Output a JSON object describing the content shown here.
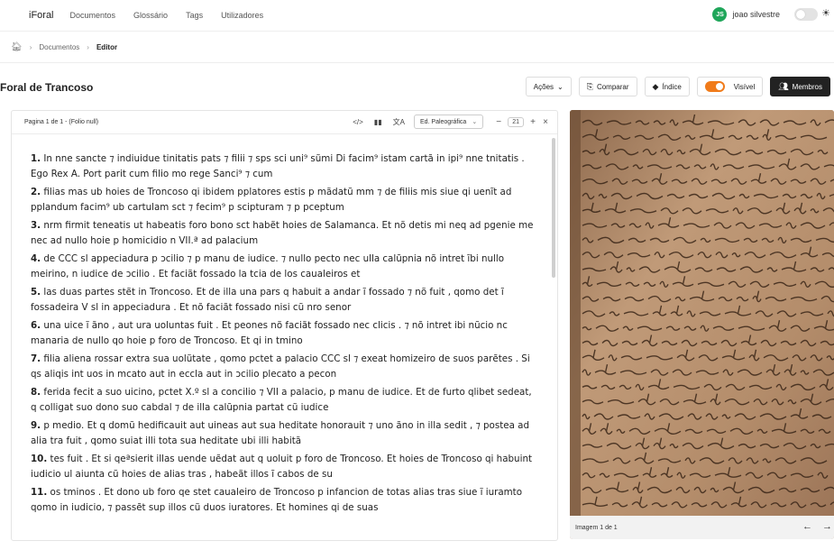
{
  "topnav": {
    "brand": "iForal",
    "links": [
      "Documentos",
      "Glossário",
      "Tags",
      "Utilizadores"
    ],
    "user": {
      "initials": "JS",
      "name": "joao silvestre",
      "avatar_color": "#1fa65a"
    }
  },
  "breadcrumb": {
    "items": [
      "Documentos",
      "Editor"
    ]
  },
  "header": {
    "title": "Foral de Trancoso",
    "buttons": {
      "actions": "Ações",
      "compare": "Comparar",
      "index": "Índice",
      "visible": "Visível",
      "members": "Membros"
    },
    "visible_on": true,
    "accent": "#f07b1a"
  },
  "editor": {
    "page_label": "Pagina 1 de 1 - (Folio null)",
    "edition": "Ed. Paleográfica",
    "zoom": "21",
    "paragraphs": [
      {
        "num": "1.",
        "text": "In nne sancte ⁊ indiuidue tinitatis pats ⁊ filii ⁊ sps sci uni⁹ sũmi Di facim⁹ istam cartã in ipi⁹ nne tnitatis . Ego Rex A. Port parit cum filio mo rege Sanci⁹ ⁊ cum"
      },
      {
        "num": "2.",
        "text": "filias mas ub hoies de Troncoso qi ibidem pplatores estis p mãdatũ mm ⁊ de filiis mis siue qi uenĩt ad pplandum facim⁹ ub cartulam sct ⁊ fecim⁹ p scipturam ⁊ p pceptum"
      },
      {
        "num": "3.",
        "text": "nrm firmit teneatis ut habeatis foro bono sct habẽt hoies de Salamanca. Et nõ detis mi neq ad pgenie me nec ad nullo hoie p homicidio n VII.ª ad palacium"
      },
      {
        "num": "4.",
        "text": "de CCC sl appeciadura p ɔcilio ⁊ p manu de iudice. ⁊ nullo pecto nec ulla calũpnia nõ intret ĩbi nullo meirino, n iudice de ɔcilio . Et faciãt fossado la tcia de los caualeiros et"
      },
      {
        "num": "5.",
        "text": "las duas partes stẽt in Troncoso. Et de illa una pars q habuit a andar ĩ fossado ⁊ nõ fuit , qomo det ĩ fossadeira V sl in appeciadura . Et nõ faciãt fossado nisi cũ nro senor"
      },
      {
        "num": "6.",
        "text": "una uice ĩ ãno , aut ura uoluntas fuit . Et peones nõ faciãt fossado nec clicis . ⁊ nõ intret ibi nũcio nc manaria de nullo qo hoie p foro de Troncoso. Et qi in tmino"
      },
      {
        "num": "7.",
        "text": "filia aliena rossar extra sua uolũtate , qomo pctet a palacio CCC sl ⁊ exeat homizeiro de suos parẽtes . Si qs aliqis int uos in mcato aut in eccla aut in ɔcilio plecato a pecon"
      },
      {
        "num": "8.",
        "text": "ferida fecit a suo uicino, pctet X.º sl a concilio ⁊ VII a palacio, p manu de iudice. Et de furto qlibet sedeat, q colligat suo dono suo cabdal ⁊ de illa calũpnia partat cũ iudice"
      },
      {
        "num": "9.",
        "text": "p medio. Et q domũ hedificauit aut uineas aut sua heditate honorauit ⁊ uno ãno in illa sedit , ⁊ postea ad alia tra fuit , qomo suiat illi tota sua heditate ubi illi habitã"
      },
      {
        "num": "10.",
        "text": "tes fuit . Et si qeªsierit illas uende uẽdat aut q uoluit p foro de Troncoso. Et hoies de Troncoso qi habuint iudicio ul aiunta cũ hoies de alias tras , habeãt illos ĩ cabos de su"
      },
      {
        "num": "11.",
        "text": "os tminos . Et dono ub foro qe stet caualeiro de Troncoso p infancion de totas alias tras siue ĩ iuramto qomo in iudicio, ⁊ passẽt sup illos cũ duos iuratores. Et homines qi de suas"
      }
    ]
  },
  "image_viewer": {
    "label": "Imagem 1 de 1"
  }
}
